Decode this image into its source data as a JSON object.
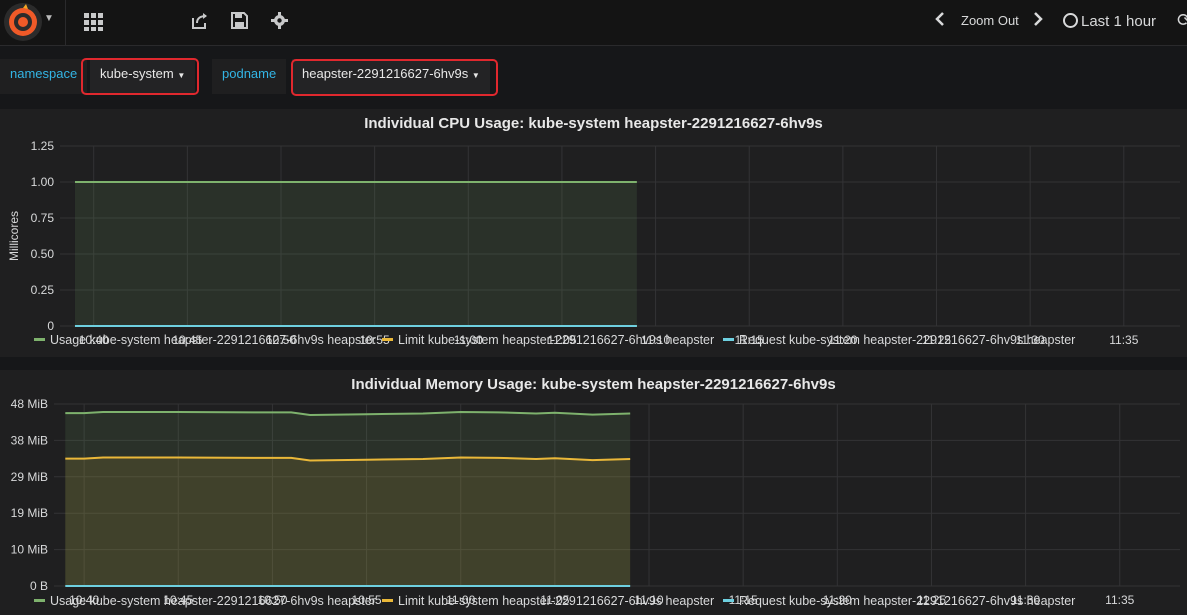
{
  "toolbar": {
    "zoom_out_label": "Zoom Out",
    "time_range_label": "Last 1 hour",
    "icons": [
      "grafana-logo-icon",
      "dashboards-icon",
      "share-icon",
      "save-icon",
      "settings-icon",
      "chevron-left-icon",
      "chevron-right-icon",
      "clock-icon",
      "refresh-icon"
    ]
  },
  "variables": {
    "namespace": {
      "label": "namespace",
      "value": "kube-system"
    },
    "podname": {
      "label": "podname",
      "value": "heapster-2291216627-6hv9s"
    }
  },
  "colors": {
    "usage": "#7eb26d",
    "limit": "#eab839",
    "request": "#6ed0e0",
    "highlight": "#e0282e",
    "variable_label": "#33b5e5"
  },
  "chart_data": [
    {
      "type": "line",
      "title": "Individual CPU Usage: kube-system heapster-2291216627-6hv9s",
      "ylabel": "Millicores",
      "yticks": [
        "0",
        "0.25",
        "0.50",
        "0.75",
        "1.00",
        "1.25"
      ],
      "ylim": [
        0,
        1.25
      ],
      "xticks": [
        "10:40",
        "10:45",
        "10:50",
        "10:55",
        "11:00",
        "11:05",
        "11:10",
        "11:15",
        "11:20",
        "11:25",
        "11:30",
        "11:35"
      ],
      "x": [
        "10:39",
        "10:40",
        "10:45",
        "10:50",
        "10:55",
        "11:00",
        "11:05",
        "11:09"
      ],
      "series": [
        {
          "name": "Usage kube-system heapster-2291216627-6hv9s heapster",
          "color": "#7eb26d",
          "fill": true,
          "values": [
            1,
            1,
            1,
            1,
            1,
            1,
            1,
            1
          ]
        },
        {
          "name": "Limit kube-system heapster-2291216627-6hv9s heapster",
          "color": "#eab839",
          "fill": false,
          "values": [
            0,
            0,
            0,
            0,
            0,
            0,
            0,
            0
          ]
        },
        {
          "name": "Request kube-system heapster-2291216627-6hv9s heapster",
          "color": "#6ed0e0",
          "fill": false,
          "values": [
            0,
            0,
            0,
            0,
            0,
            0,
            0,
            0
          ]
        }
      ],
      "grid": true,
      "legend": "bottom"
    },
    {
      "type": "line",
      "title": "Individual Memory Usage: kube-system heapster-2291216627-6hv9s",
      "ylabel": "",
      "yticks": [
        "0 B",
        "10 MiB",
        "19 MiB",
        "29 MiB",
        "38 MiB",
        "48 MiB"
      ],
      "ylim": [
        0,
        48
      ],
      "xticks": [
        "10:40",
        "10:45",
        "10:50",
        "10:55",
        "11:00",
        "11:05",
        "11:10",
        "11:15",
        "11:20",
        "11:25",
        "11:30",
        "11:35"
      ],
      "x": [
        "10:39",
        "10:40",
        "10:41",
        "10:45",
        "10:49",
        "10:51",
        "10:52",
        "10:55",
        "10:58",
        "11:00",
        "11:02",
        "11:04",
        "11:05",
        "11:07",
        "11:09"
      ],
      "series": [
        {
          "name": "Usage kube-system heapster-2291216627-6hv9s heapster",
          "color": "#7eb26d",
          "fill": true,
          "values": [
            45.6,
            45.6,
            45.9,
            45.9,
            45.8,
            45.8,
            45.1,
            45.3,
            45.5,
            45.9,
            45.8,
            45.5,
            45.7,
            45.2,
            45.5
          ]
        },
        {
          "name": "Limit kube-system heapster-2291216627-6hv9s heapster",
          "color": "#eab839",
          "fill": true,
          "values": [
            33.6,
            33.6,
            33.9,
            33.9,
            33.8,
            33.8,
            33.1,
            33.3,
            33.5,
            33.9,
            33.8,
            33.5,
            33.7,
            33.2,
            33.5
          ]
        },
        {
          "name": "Request kube-system heapster-2291216627-6hv9s heapster",
          "color": "#6ed0e0",
          "fill": false,
          "values": [
            0,
            0,
            0,
            0,
            0,
            0,
            0,
            0,
            0,
            0,
            0,
            0,
            0,
            0,
            0
          ]
        }
      ],
      "grid": true,
      "legend": "bottom"
    }
  ]
}
